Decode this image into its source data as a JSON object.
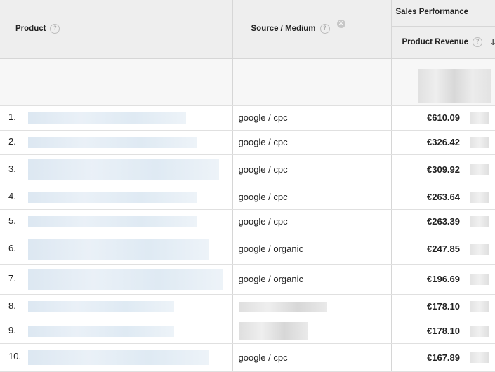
{
  "header": {
    "product_label": "Product",
    "source_medium_label": "Source / Medium",
    "sales_performance_label": "Sales Performance",
    "product_revenue_label": "Product Revenue",
    "help_glyph": "?",
    "remove_glyph": "✕",
    "sort_glyph": "↓"
  },
  "rows": [
    {
      "index": "1.",
      "source": "google / cpc",
      "revenue": "€610.09"
    },
    {
      "index": "2.",
      "source": "google / cpc",
      "revenue": "€326.42"
    },
    {
      "index": "3.",
      "source": "google / cpc",
      "revenue": "€309.92"
    },
    {
      "index": "4.",
      "source": "google / cpc",
      "revenue": "€263.64"
    },
    {
      "index": "5.",
      "source": "google / cpc",
      "revenue": "€263.39"
    },
    {
      "index": "6.",
      "source": "google / organic",
      "revenue": "€247.85"
    },
    {
      "index": "7.",
      "source": "google / organic",
      "revenue": "€196.69"
    },
    {
      "index": "8.",
      "source": "",
      "revenue": "€178.10"
    },
    {
      "index": "9.",
      "source": "",
      "revenue": "€178.10"
    },
    {
      "index": "10.",
      "source": "google / cpc",
      "revenue": "€167.89"
    }
  ],
  "colors": {
    "header_bg": "#eeeeee",
    "total_bg": "#f7f7f7",
    "blur_blue": "#d6e3ef",
    "border": "#d6d6d6"
  },
  "icons": {
    "help": "help-icon",
    "remove": "remove-icon",
    "sort": "sort-descending-icon"
  }
}
